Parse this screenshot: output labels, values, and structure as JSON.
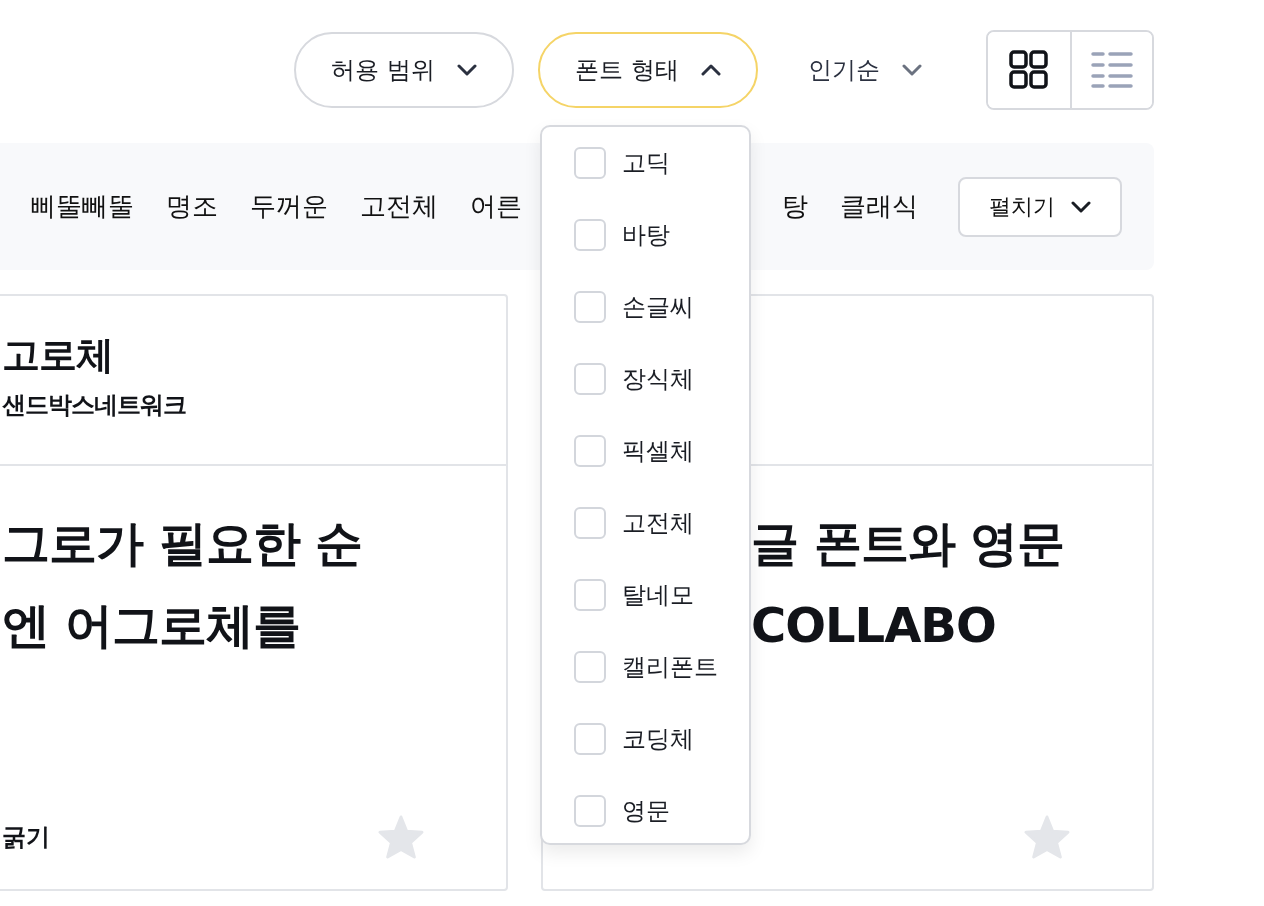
{
  "filters": [
    {
      "label": "허용 범위",
      "kind": "pill",
      "expanded": false
    },
    {
      "label": "폰트 형태",
      "kind": "pill",
      "expanded": true
    },
    {
      "label": "인기순",
      "kind": "plain",
      "expanded": false
    }
  ],
  "view_toggle": [
    {
      "kind": "grid",
      "selected": true
    },
    {
      "kind": "list",
      "selected": false
    }
  ],
  "tags": [
    "삐뚤빼뚤",
    "명조",
    "두꺼운",
    "고전체",
    "어른",
    "탕",
    "클래식"
  ],
  "expand_button": "펼치기",
  "cards": [
    {
      "title": "고로체",
      "maker": "샌드박스네트워크",
      "sample": [
        "그로가 필요한 순",
        "엔 어그로체를"
      ],
      "footer": "굵기",
      "favorite": false
    },
    {
      "sample": [
        "글 폰트와 영문",
        "COLLABO"
      ],
      "favorite": false
    }
  ],
  "dropdown": {
    "options": [
      {
        "label": "고딕",
        "checked": false
      },
      {
        "label": "바탕",
        "checked": false
      },
      {
        "label": "손글씨",
        "checked": false
      },
      {
        "label": "장식체",
        "checked": false
      },
      {
        "label": "픽셀체",
        "checked": false
      },
      {
        "label": "고전체",
        "checked": false
      },
      {
        "label": "탈네모",
        "checked": false
      },
      {
        "label": "캘리폰트",
        "checked": false
      },
      {
        "label": "코딩체",
        "checked": false
      },
      {
        "label": "영문",
        "checked": false
      }
    ]
  }
}
